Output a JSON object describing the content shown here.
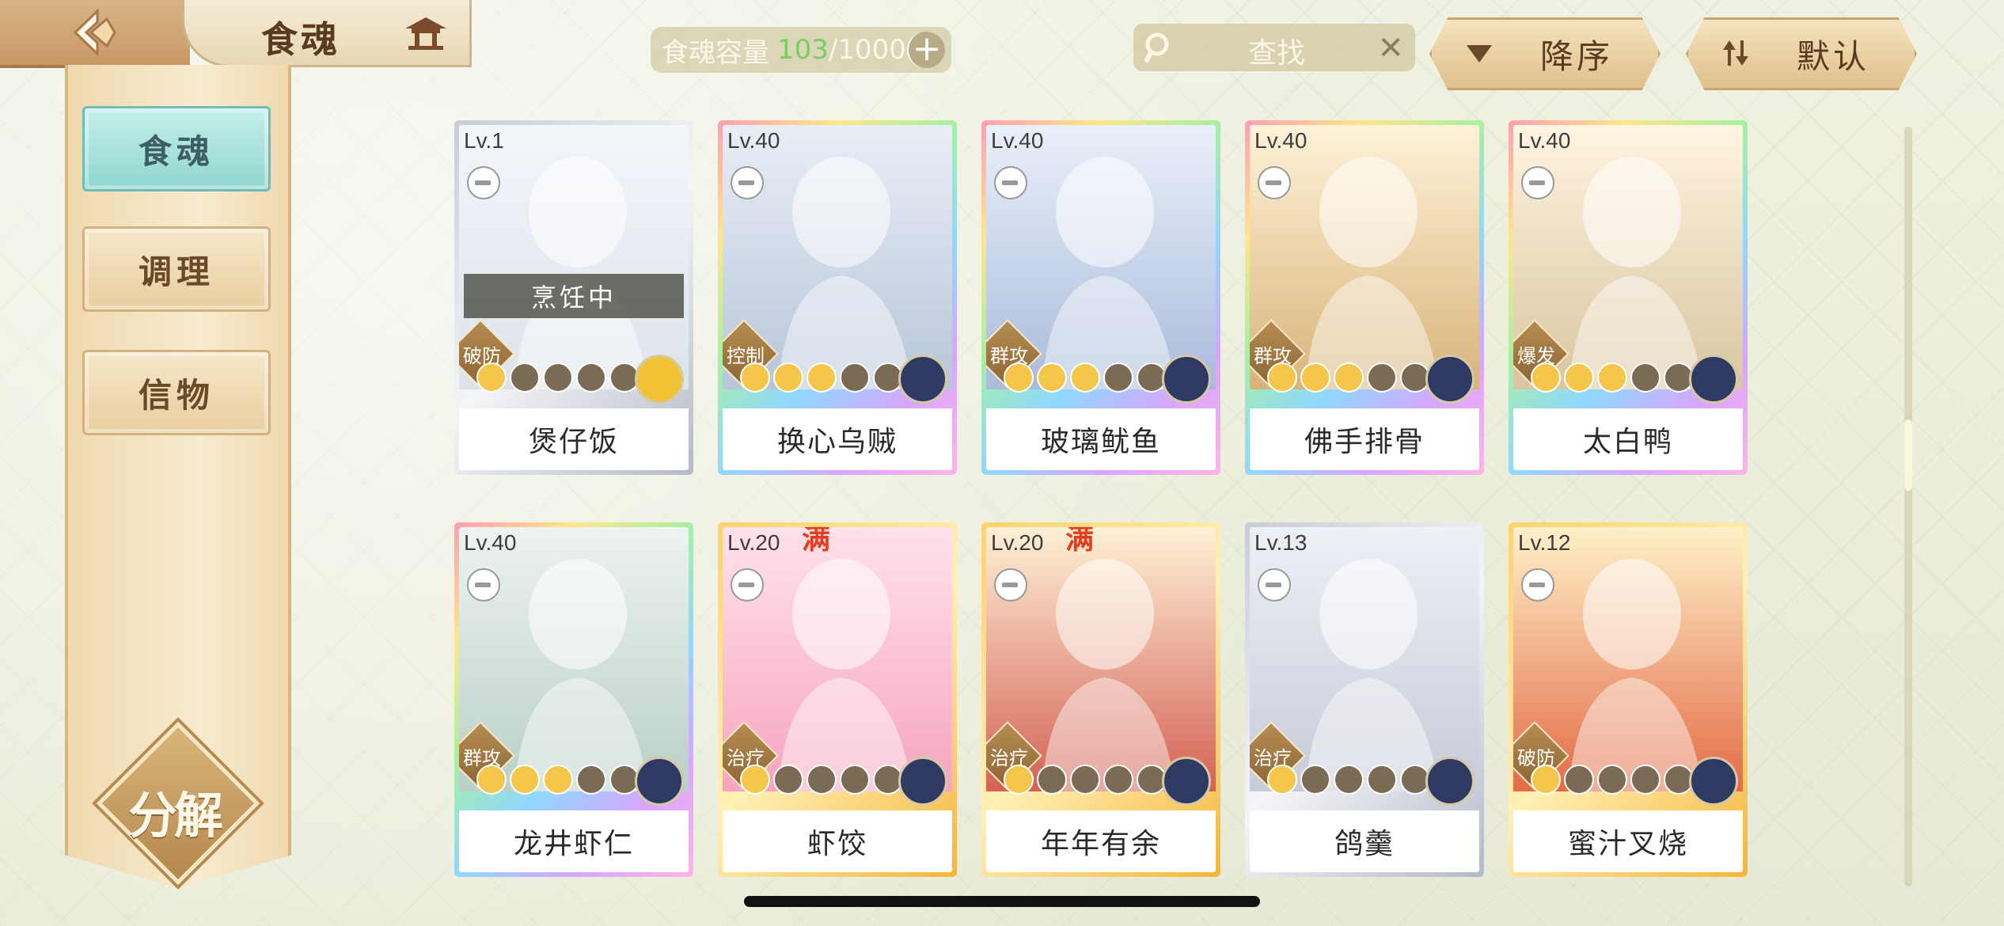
{
  "header": {
    "title": "食魂",
    "capacity_label": "食魂容量",
    "capacity_current": "103",
    "capacity_max": "/1000",
    "search_placeholder": "查找",
    "sort_order_label": "降序",
    "sort_mode_label": "默认"
  },
  "sidebar": {
    "tabs": [
      {
        "label": "食魂",
        "active": true
      },
      {
        "label": "调理",
        "active": false
      },
      {
        "label": "信物",
        "active": false
      }
    ],
    "decompose_label": "分解"
  },
  "cards": [
    {
      "level": "Lv.1",
      "name": "煲仔饭",
      "role": "破防",
      "stars_filled": 1,
      "stars_total": 5,
      "status": "烹饪中",
      "frame": "silver",
      "emblem": "gold",
      "full": ""
    },
    {
      "level": "Lv.40",
      "name": "换心乌贼",
      "role": "控制",
      "stars_filled": 3,
      "stars_total": 5,
      "status": "",
      "frame": "rainbow",
      "emblem": "navy",
      "full": ""
    },
    {
      "level": "Lv.40",
      "name": "玻璃鱿鱼",
      "role": "群攻",
      "stars_filled": 3,
      "stars_total": 5,
      "status": "",
      "frame": "rainbow",
      "emblem": "navy",
      "full": ""
    },
    {
      "level": "Lv.40",
      "name": "佛手排骨",
      "role": "群攻",
      "stars_filled": 3,
      "stars_total": 5,
      "status": "",
      "frame": "rainbow",
      "emblem": "navy",
      "full": ""
    },
    {
      "level": "Lv.40",
      "name": "太白鸭",
      "role": "爆发",
      "stars_filled": 3,
      "stars_total": 5,
      "status": "",
      "frame": "rainbow",
      "emblem": "navy",
      "full": ""
    },
    {
      "level": "Lv.40",
      "name": "龙井虾仁",
      "role": "群攻",
      "stars_filled": 3,
      "stars_total": 5,
      "status": "",
      "frame": "rainbow",
      "emblem": "navy",
      "full": ""
    },
    {
      "level": "Lv.20",
      "name": "虾饺",
      "role": "治疗",
      "stars_filled": 1,
      "stars_total": 5,
      "status": "",
      "frame": "gold",
      "emblem": "navy",
      "full": "满"
    },
    {
      "level": "Lv.20",
      "name": "年年有余",
      "role": "治疗",
      "stars_filled": 1,
      "stars_total": 5,
      "status": "",
      "frame": "gold",
      "emblem": "navy",
      "full": "满"
    },
    {
      "level": "Lv.13",
      "name": "鸽羹",
      "role": "治疗",
      "stars_filled": 1,
      "stars_total": 5,
      "status": "",
      "frame": "silver",
      "emblem": "navy",
      "full": ""
    },
    {
      "level": "Lv.12",
      "name": "蜜汁叉烧",
      "role": "破防",
      "stars_filled": 1,
      "stars_total": 5,
      "status": "",
      "frame": "gold",
      "emblem": "navy",
      "full": ""
    }
  ],
  "colors": {
    "accent_teal": "#8fd6cf",
    "capacity_green": "#77d05f",
    "gold": "#f4c64a"
  }
}
